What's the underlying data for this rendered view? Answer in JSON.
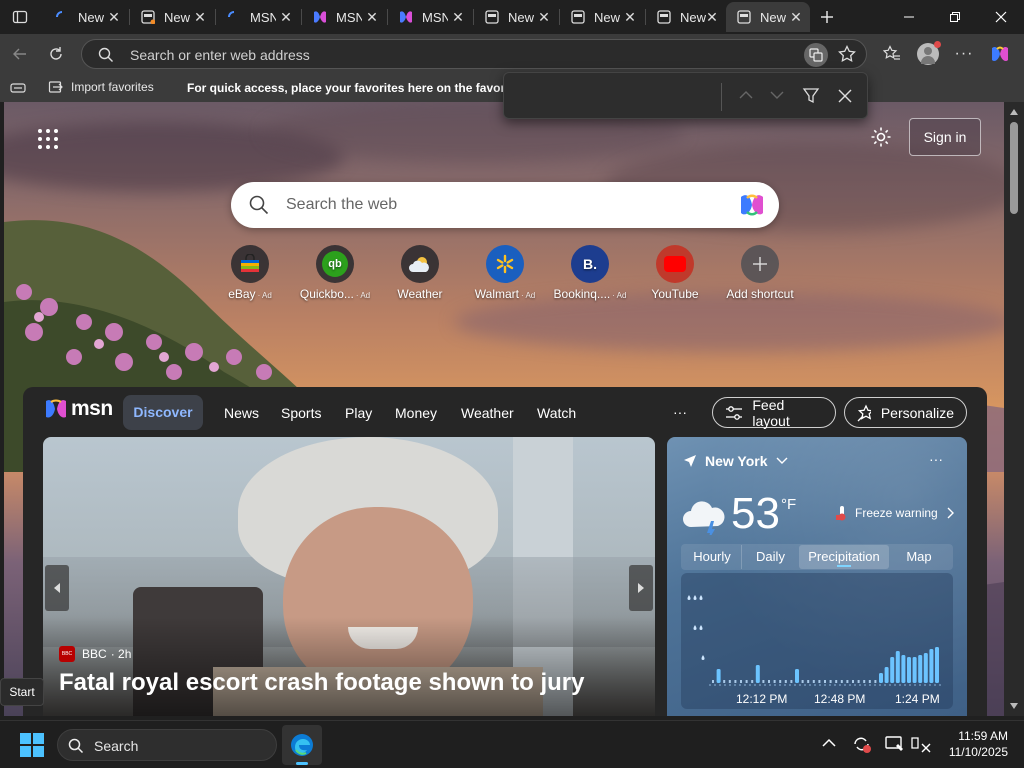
{
  "tabs": [
    {
      "title": "New",
      "icon": "loading-icon"
    },
    {
      "title": "New",
      "icon": "new-tab-icon"
    },
    {
      "title": "MSN",
      "icon": "loading-icon"
    },
    {
      "title": "MSN",
      "icon": "copilot-icon"
    },
    {
      "title": "MSN",
      "icon": "copilot-icon"
    },
    {
      "title": "New",
      "icon": "new-tab-icon"
    },
    {
      "title": "New",
      "icon": "new-tab-icon"
    },
    {
      "title": "New",
      "icon": "new-tab-icon"
    },
    {
      "title": "New",
      "icon": "new-tab-icon"
    }
  ],
  "address_bar": {
    "placeholder": "Search or enter web address"
  },
  "favorites_bar": {
    "import_label": "Import favorites",
    "hint": "For quick access, place your favorites here on the favorites"
  },
  "page": {
    "sign_in": "Sign in",
    "search_placeholder": "Search the web",
    "shortcuts": [
      {
        "label": "eBay",
        "ad": "· Ad",
        "color": "#1f2a44"
      },
      {
        "label": "Quickbo...",
        "ad": "· Ad",
        "color": "#2ca01c"
      },
      {
        "label": "Weather",
        "ad": "",
        "color": "#3a4a5a"
      },
      {
        "label": "Walmart",
        "ad": "· Ad",
        "color": "#1a5fbf"
      },
      {
        "label": "Bookinq....",
        "ad": "· Ad",
        "color": "#1d3d8f"
      },
      {
        "label": "YouTube",
        "ad": "",
        "color": "#c0392b"
      },
      {
        "label": "Add shortcut",
        "ad": "",
        "color": "#555"
      }
    ]
  },
  "feed": {
    "logo": "msn",
    "nav": [
      "Discover",
      "News",
      "Sports",
      "Play",
      "Money",
      "Weather",
      "Watch"
    ],
    "more": "···",
    "feed_layout": "Feed layout",
    "personalize": "Personalize",
    "hero": {
      "source": "BBC",
      "age": "· 2h",
      "headline": "Fatal royal escort crash footage shown to jury"
    },
    "weather": {
      "city": "New York",
      "temp": "53",
      "unit": "°F",
      "alert": "Freeze warning",
      "tabs": [
        "Hourly",
        "Daily",
        "Precipitation",
        "Map"
      ],
      "times": [
        "12:12 PM",
        "12:48 PM",
        "1:24 PM"
      ],
      "more": "···"
    }
  },
  "taskbar": {
    "search": "Search",
    "time": "11:59 AM",
    "date": "11/10/2025",
    "tooltip": "Start"
  }
}
